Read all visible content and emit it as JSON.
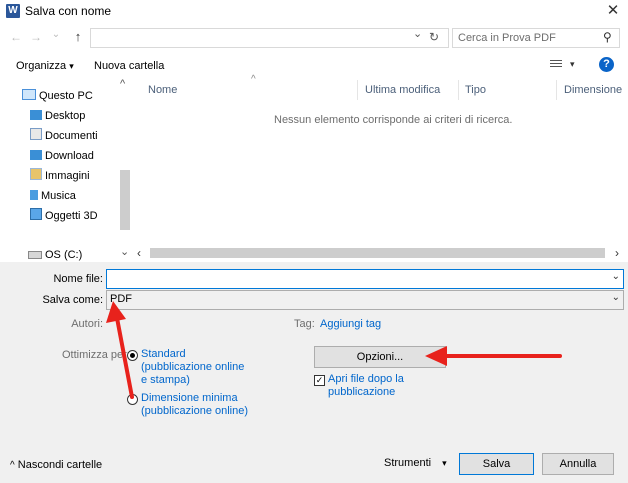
{
  "window": {
    "title": "Salva con nome",
    "app_icon_letter": "W",
    "close_glyph": "✕"
  },
  "nav": {
    "back_glyph": "←",
    "forward_glyph": "→",
    "dropdown_glyph": "⌄",
    "up_glyph": "↑",
    "address_dropdown_glyph": "⌄",
    "refresh_glyph": "↻",
    "search_placeholder": "Cerca in Prova PDF",
    "search_glyph": "⚲"
  },
  "toolbar": {
    "organize_label": "Organizza",
    "organize_glyph": "▾",
    "new_folder_label": "Nuova cartella",
    "view_glyph": "▾",
    "help_glyph": "?"
  },
  "sidebar": {
    "root": {
      "label": "Questo PC",
      "expand_glyph": "⌄"
    },
    "items": [
      {
        "label": "Desktop",
        "icon": "desktop-icon"
      },
      {
        "label": "Documenti",
        "icon": "documents-icon"
      },
      {
        "label": "Download",
        "icon": "download-icon"
      },
      {
        "label": "Immagini",
        "icon": "pictures-icon"
      },
      {
        "label": "Musica",
        "icon": "music-icon"
      },
      {
        "label": "Oggetti 3D",
        "icon": "3d-objects-icon"
      }
    ],
    "drive": {
      "label": "OS (C:)",
      "icon": "drive-icon"
    }
  },
  "filelist": {
    "columns": [
      "Nome",
      "Ultima modifica",
      "Tipo",
      "Dimensione"
    ],
    "empty_message": "Nessun elemento corrisponde ai criteri di ricerca.",
    "sort_glyph": "^"
  },
  "form": {
    "filename_label": "Nome file:",
    "filename_value": "",
    "savetype_label": "Salva come:",
    "savetype_value": "PDF",
    "authors_label": "Autori:",
    "tags_label": "Tag:",
    "tags_link": "Aggiungi tag",
    "optimize_label": "Ottimizza per:",
    "optimize_options": [
      {
        "line1": "Standard",
        "line2": "(pubblicazione online",
        "line3": "e stampa)",
        "checked": true
      },
      {
        "line1": "Dimensione minima",
        "line2": "(pubblicazione online)",
        "checked": false
      }
    ],
    "options_button": "Opzioni...",
    "open_after_line1": "Apri file dopo la",
    "open_after_line2": "pubblicazione",
    "open_after_checked": true
  },
  "footer": {
    "hide_folders": "Nascondi cartelle",
    "hide_glyph": "^",
    "tools_label": "Strumenti",
    "tools_glyph": "▾",
    "save_button": "Salva",
    "cancel_button": "Annulla"
  },
  "colors": {
    "annotation_arrow": "#e8221c",
    "link": "#0066cc",
    "accent": "#0078d7"
  }
}
